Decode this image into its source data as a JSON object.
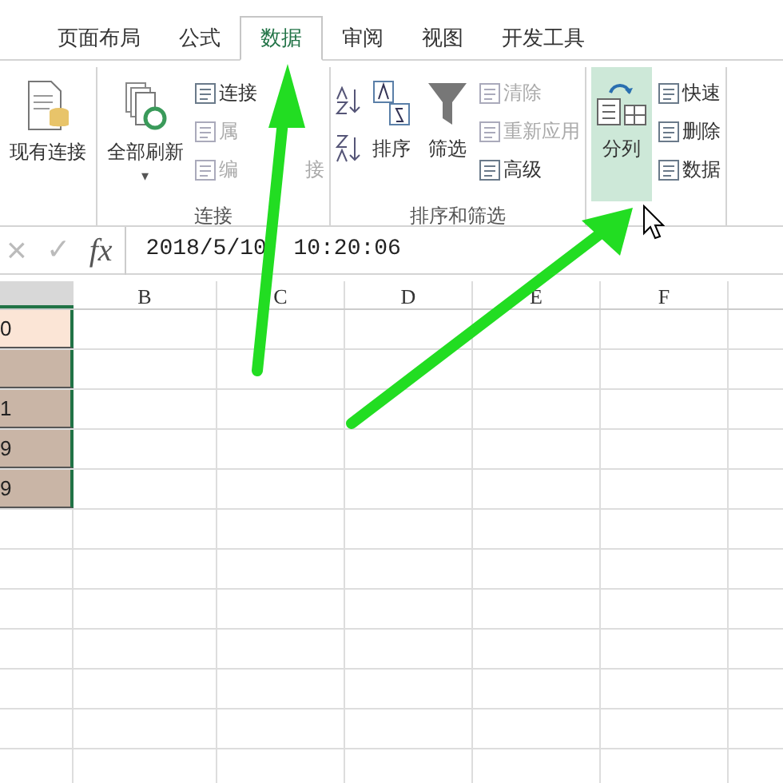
{
  "tabs": [
    {
      "label": "页面布局",
      "selected": false
    },
    {
      "label": "公式",
      "selected": false
    },
    {
      "label": "数据",
      "selected": true
    },
    {
      "label": "审阅",
      "selected": false
    },
    {
      "label": "视图",
      "selected": false
    },
    {
      "label": "开发工具",
      "selected": false
    }
  ],
  "ribbon": {
    "groups": [
      {
        "items": [
          {
            "kind": "large",
            "label": "现有连接"
          }
        ]
      },
      {
        "label": "连接",
        "items": [
          {
            "kind": "large",
            "label": "全部刷新",
            "dropdown": "▾"
          },
          {
            "kind": "small",
            "label": "连接",
            "disabled": false
          },
          {
            "kind": "small",
            "label": "属",
            "disabled": true
          },
          {
            "kind": "small",
            "label": "编",
            "tail": "接",
            "disabled": true
          }
        ]
      },
      {
        "label": "排序和筛选",
        "items": [
          {
            "kind": "sortpair"
          },
          {
            "kind": "large",
            "label": "排序"
          },
          {
            "kind": "large",
            "label": "筛选"
          },
          {
            "kind": "small",
            "label": "清除",
            "disabled": true
          },
          {
            "kind": "small",
            "label": "重新应用",
            "disabled": true
          },
          {
            "kind": "small",
            "label": "高级",
            "disabled": false
          }
        ]
      },
      {
        "items": [
          {
            "kind": "large",
            "label": "分列",
            "selected": true
          },
          {
            "kind": "small",
            "label": "快速",
            "disabled": false
          },
          {
            "kind": "small",
            "label": "删除",
            "disabled": false
          },
          {
            "kind": "small",
            "label": "数据",
            "disabled": false
          }
        ]
      }
    ]
  },
  "formula_bar": {
    "cancel": "×",
    "enter": "✓",
    "fx": "fx",
    "value": "2018/5/10  10:20:06"
  },
  "sheet": {
    "columns": [
      "B",
      "C",
      "D",
      "E",
      "F"
    ],
    "column_a": [
      {
        "value": "0",
        "color": "#fbe5d6"
      },
      {
        "color": "#c9b5a6"
      },
      {
        "value": "1",
        "color": "#c9b5a6"
      },
      {
        "value": "9",
        "color": "#c9b5a6"
      },
      {
        "value": "9",
        "color": "#c9b5a6"
      }
    ]
  }
}
